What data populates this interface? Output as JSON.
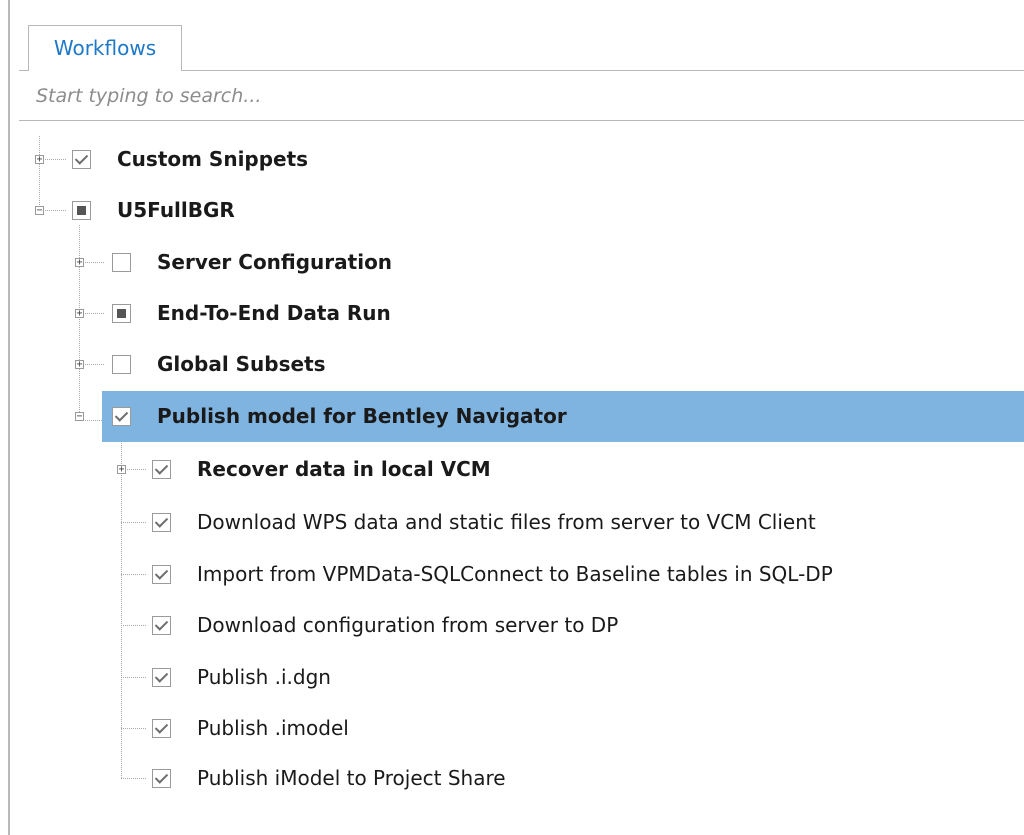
{
  "tabs": [
    {
      "label": "Workflows",
      "active": true
    }
  ],
  "search": {
    "placeholder": "Start typing to search...",
    "value": ""
  },
  "tree": {
    "custom_snippets": {
      "label": "Custom Snippets",
      "state": "checked",
      "expander": "+"
    },
    "u5fullbgr": {
      "label": "U5FullBGR",
      "state": "partial",
      "expander": "−",
      "children": {
        "server_config": {
          "label": "Server Configuration",
          "state": "unchecked",
          "expander": "+"
        },
        "end_to_end": {
          "label": "End-To-End Data Run",
          "state": "partial",
          "expander": "+"
        },
        "global_subsets": {
          "label": "Global Subsets",
          "state": "unchecked",
          "expander": "+"
        },
        "publish_model": {
          "label": "Publish model for Bentley Navigator",
          "state": "checked",
          "expander": "−",
          "selected": true,
          "children": [
            {
              "label": "Recover data in local VCM",
              "state": "checked",
              "expander": "+"
            },
            {
              "label": "Download WPS data and static files from server to VCM Client",
              "state": "checked"
            },
            {
              "label": "Import from VPMData-SQLConnect to Baseline tables in SQL-DP",
              "state": "checked"
            },
            {
              "label": "Download configuration from server to DP",
              "state": "checked"
            },
            {
              "label": "Publish .i.dgn",
              "state": "checked"
            },
            {
              "label": "Publish .imodel",
              "state": "checked"
            },
            {
              "label": "Publish iModel to Project Share",
              "state": "checked"
            }
          ]
        }
      }
    }
  },
  "colors": {
    "accent": "#1e78c8",
    "selection": "#7fb4e1",
    "border": "#b8b8b8"
  }
}
